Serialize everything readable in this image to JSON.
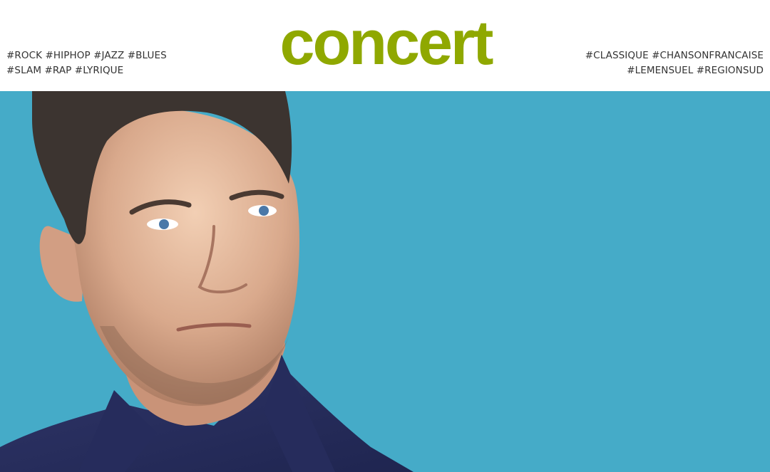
{
  "header": {
    "logo_text": "concert",
    "tags_left": [
      "#ROCK #HIPHOP #JAZZ #BLUES",
      "#SLAM #RAP #LYRIQUE"
    ],
    "tags_right": [
      "#CLASSIQUE #CHANSONFRANCAISE",
      "#LEMENSUEL #REGIONSUD"
    ]
  },
  "colors": {
    "logo": "#8fa800",
    "hero_background": "#45abc8",
    "tag_text": "#333333"
  }
}
